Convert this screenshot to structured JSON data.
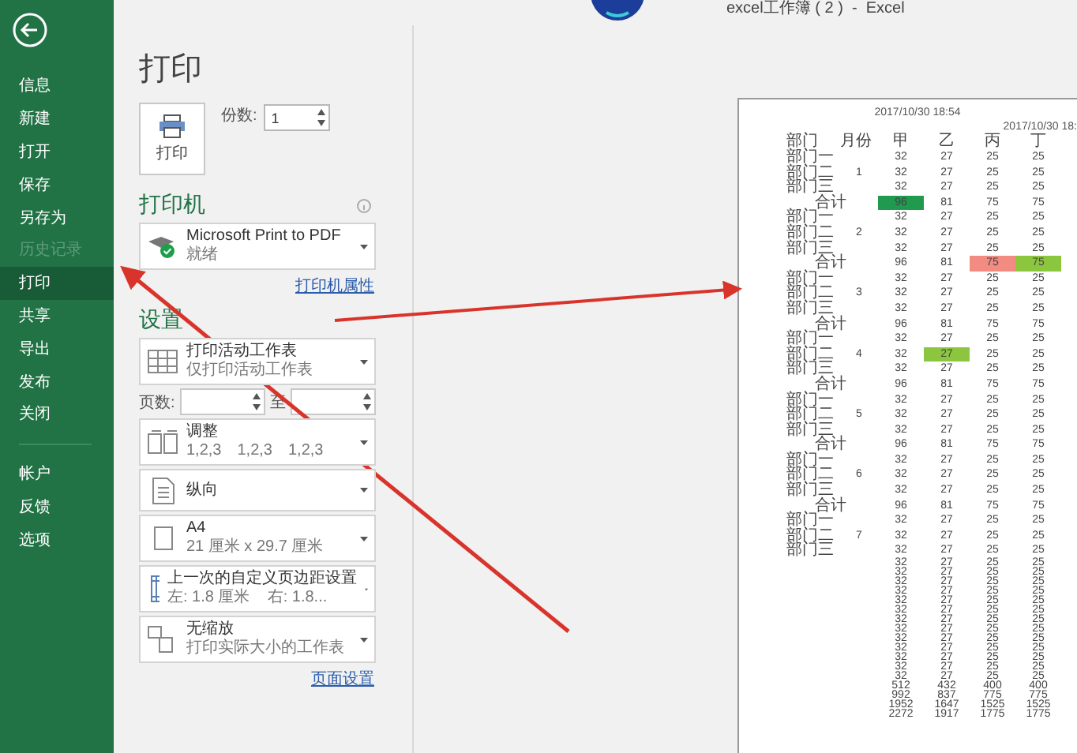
{
  "window": {
    "title": "excel工作簿 ( 2 )  -  Excel"
  },
  "sidebar": {
    "items": [
      {
        "label": "信息",
        "selected": false,
        "disabled": false
      },
      {
        "label": "新建",
        "selected": false,
        "disabled": false
      },
      {
        "label": "打开",
        "selected": false,
        "disabled": false
      },
      {
        "label": "保存",
        "selected": false,
        "disabled": false
      },
      {
        "label": "另存为",
        "selected": false,
        "disabled": false
      },
      {
        "label": "历史记录",
        "selected": false,
        "disabled": true
      },
      {
        "label": "打印",
        "selected": true,
        "disabled": false
      },
      {
        "label": "共享",
        "selected": false,
        "disabled": false
      },
      {
        "label": "导出",
        "selected": false,
        "disabled": false
      },
      {
        "label": "发布",
        "selected": false,
        "disabled": false
      },
      {
        "label": "关闭",
        "selected": false,
        "disabled": false
      }
    ],
    "footer_items": [
      {
        "label": "帐户",
        "selected": false,
        "disabled": false
      },
      {
        "label": "反馈",
        "selected": false,
        "disabled": false
      },
      {
        "label": "选项",
        "selected": false,
        "disabled": false
      }
    ]
  },
  "print": {
    "title": "打印",
    "button": "打印",
    "copies_label": "份数:",
    "copies": "1"
  },
  "printer": {
    "heading": "打印机",
    "name": "Microsoft Print to PDF",
    "status": "就绪",
    "link": "打印机属性"
  },
  "settings": {
    "heading": "设置",
    "items": [
      {
        "kind": "sheets",
        "main": "打印活动工作表",
        "sub": "仅打印活动工作表"
      },
      {
        "kind": "pages",
        "label": "页数:",
        "to": "至"
      },
      {
        "kind": "collate",
        "main": "调整",
        "parts": [
          "1,2,3",
          "1,2,3",
          "1,2,3"
        ]
      },
      {
        "kind": "orientation",
        "main": "纵向"
      },
      {
        "kind": "paper",
        "main": "A4",
        "sub": "21 厘米 x 29.7 厘米"
      },
      {
        "kind": "margins",
        "main": "上一次的自定义页边距设置",
        "sub": "左: 1.8 厘米    右: 1.8..."
      },
      {
        "kind": "scaling",
        "main": "无缩放",
        "sub": "打印实际大小的工作表"
      }
    ],
    "link": "页面设置"
  },
  "preview": {
    "dates": [
      "2017/10/30 18:54",
      "2017/10/30 18:"
    ],
    "columns": [
      "部门",
      "月份",
      "甲",
      "乙",
      "丙",
      "丁"
    ],
    "rows": [
      {
        "kind": "dept",
        "label": "部门一",
        "values": [
          "32",
          "27",
          "25",
          "25"
        ]
      },
      {
        "kind": "dept",
        "label": "部门二",
        "month": "1",
        "values": [
          "32",
          "27",
          "25",
          "25"
        ]
      },
      {
        "kind": "dept",
        "label": "部门三",
        "values": [
          "32",
          "27",
          "25",
          "25"
        ]
      },
      {
        "kind": "total",
        "label": "合计",
        "values": [
          {
            "text": "96",
            "color": "#1f9a4f"
          },
          {
            "text": "81"
          },
          {
            "text": "75"
          },
          {
            "text": "75"
          }
        ]
      },
      {
        "kind": "dept",
        "label": "部门一",
        "values": [
          "32",
          "27",
          "25",
          "25"
        ]
      },
      {
        "kind": "dept",
        "label": "部门二",
        "month": "2",
        "values": [
          "32",
          "27",
          "25",
          "25"
        ]
      },
      {
        "kind": "dept",
        "label": "部门三",
        "values": [
          "32",
          "27",
          "25",
          "25"
        ]
      },
      {
        "kind": "total",
        "label": "合计",
        "values": [
          {
            "text": "96"
          },
          {
            "text": "81"
          },
          {
            "text": "75",
            "color": "#f28b82"
          },
          {
            "text": "75",
            "color": "#8cc63f"
          }
        ]
      },
      {
        "kind": "dept",
        "label": "部门一",
        "values": [
          "32",
          "27",
          "25",
          "25"
        ]
      },
      {
        "kind": "dept",
        "label": "部门二",
        "month": "3",
        "values": [
          "32",
          "27",
          "25",
          "25"
        ]
      },
      {
        "kind": "dept",
        "label": "部门三",
        "values": [
          "32",
          "27",
          "25",
          "25"
        ]
      },
      {
        "kind": "total",
        "label": "合计",
        "values": [
          "96",
          "81",
          "75",
          "75"
        ]
      },
      {
        "kind": "dept",
        "label": "部门一",
        "values": [
          "32",
          "27",
          "25",
          "25"
        ]
      },
      {
        "kind": "dept",
        "label": "部门二",
        "month": "4",
        "values": [
          {
            "text": "32"
          },
          {
            "text": "27",
            "color": "#8cc63f"
          },
          {
            "text": "25"
          },
          {
            "text": "25"
          }
        ]
      },
      {
        "kind": "dept",
        "label": "部门三",
        "values": [
          "32",
          "27",
          "25",
          "25"
        ]
      },
      {
        "kind": "total",
        "label": "合计",
        "values": [
          "96",
          "81",
          "75",
          "75"
        ]
      },
      {
        "kind": "dept",
        "label": "部门一",
        "values": [
          "32",
          "27",
          "25",
          "25"
        ]
      },
      {
        "kind": "dept",
        "label": "部门二",
        "month": "5",
        "values": [
          "32",
          "27",
          "25",
          "25"
        ]
      },
      {
        "kind": "dept",
        "label": "部门三",
        "values": [
          "32",
          "27",
          "25",
          "25"
        ]
      },
      {
        "kind": "total",
        "label": "合计",
        "values": [
          "96",
          "81",
          "75",
          "75"
        ]
      },
      {
        "kind": "dept",
        "label": "部门一",
        "values": [
          "32",
          "27",
          "25",
          "25"
        ]
      },
      {
        "kind": "dept",
        "label": "部门二",
        "month": "6",
        "values": [
          "32",
          "27",
          "25",
          "25"
        ]
      },
      {
        "kind": "dept",
        "label": "部门三",
        "values": [
          "32",
          "27",
          "25",
          "25"
        ]
      },
      {
        "kind": "total",
        "label": "合计",
        "values": [
          "96",
          "81",
          "75",
          "75"
        ]
      },
      {
        "kind": "dept",
        "label": "部门一",
        "values": [
          "32",
          "27",
          "25",
          "25"
        ]
      },
      {
        "kind": "dept",
        "label": "部门二",
        "month": "7",
        "values": [
          "32",
          "27",
          "25",
          "25"
        ]
      },
      {
        "kind": "dept",
        "label": "部门三",
        "values": [
          "32",
          "27",
          "25",
          "25"
        ]
      },
      {
        "kind": "plain",
        "values": [
          "32",
          "27",
          "25",
          "25"
        ]
      },
      {
        "kind": "plain",
        "values": [
          "32",
          "27",
          "25",
          "25"
        ]
      },
      {
        "kind": "plain",
        "values": [
          "32",
          "27",
          "25",
          "25"
        ]
      },
      {
        "kind": "plain",
        "values": [
          "32",
          "27",
          "25",
          "25"
        ]
      },
      {
        "kind": "plain",
        "values": [
          "32",
          "27",
          "25",
          "25"
        ]
      },
      {
        "kind": "plain",
        "values": [
          "32",
          "27",
          "25",
          "25"
        ]
      },
      {
        "kind": "plain",
        "values": [
          "32",
          "27",
          "25",
          "25"
        ]
      },
      {
        "kind": "plain",
        "values": [
          "32",
          "27",
          "25",
          "25"
        ]
      },
      {
        "kind": "plain",
        "values": [
          "32",
          "27",
          "25",
          "25"
        ]
      },
      {
        "kind": "plain",
        "values": [
          "32",
          "27",
          "25",
          "25"
        ]
      },
      {
        "kind": "plain",
        "values": [
          "32",
          "27",
          "25",
          "25"
        ]
      },
      {
        "kind": "plain",
        "values": [
          "32",
          "27",
          "25",
          "25"
        ]
      },
      {
        "kind": "plain",
        "values": [
          "32",
          "27",
          "25",
          "25"
        ]
      },
      {
        "kind": "plain",
        "values": [
          "512",
          "432",
          "400",
          "400"
        ]
      },
      {
        "kind": "plain",
        "values": [
          "992",
          "837",
          "775",
          "775"
        ]
      },
      {
        "kind": "plain",
        "values": [
          "1952",
          "1647",
          "1525",
          "1525"
        ]
      },
      {
        "kind": "plain",
        "values": [
          "2272",
          "1917",
          "1775",
          "1775"
        ]
      }
    ]
  }
}
